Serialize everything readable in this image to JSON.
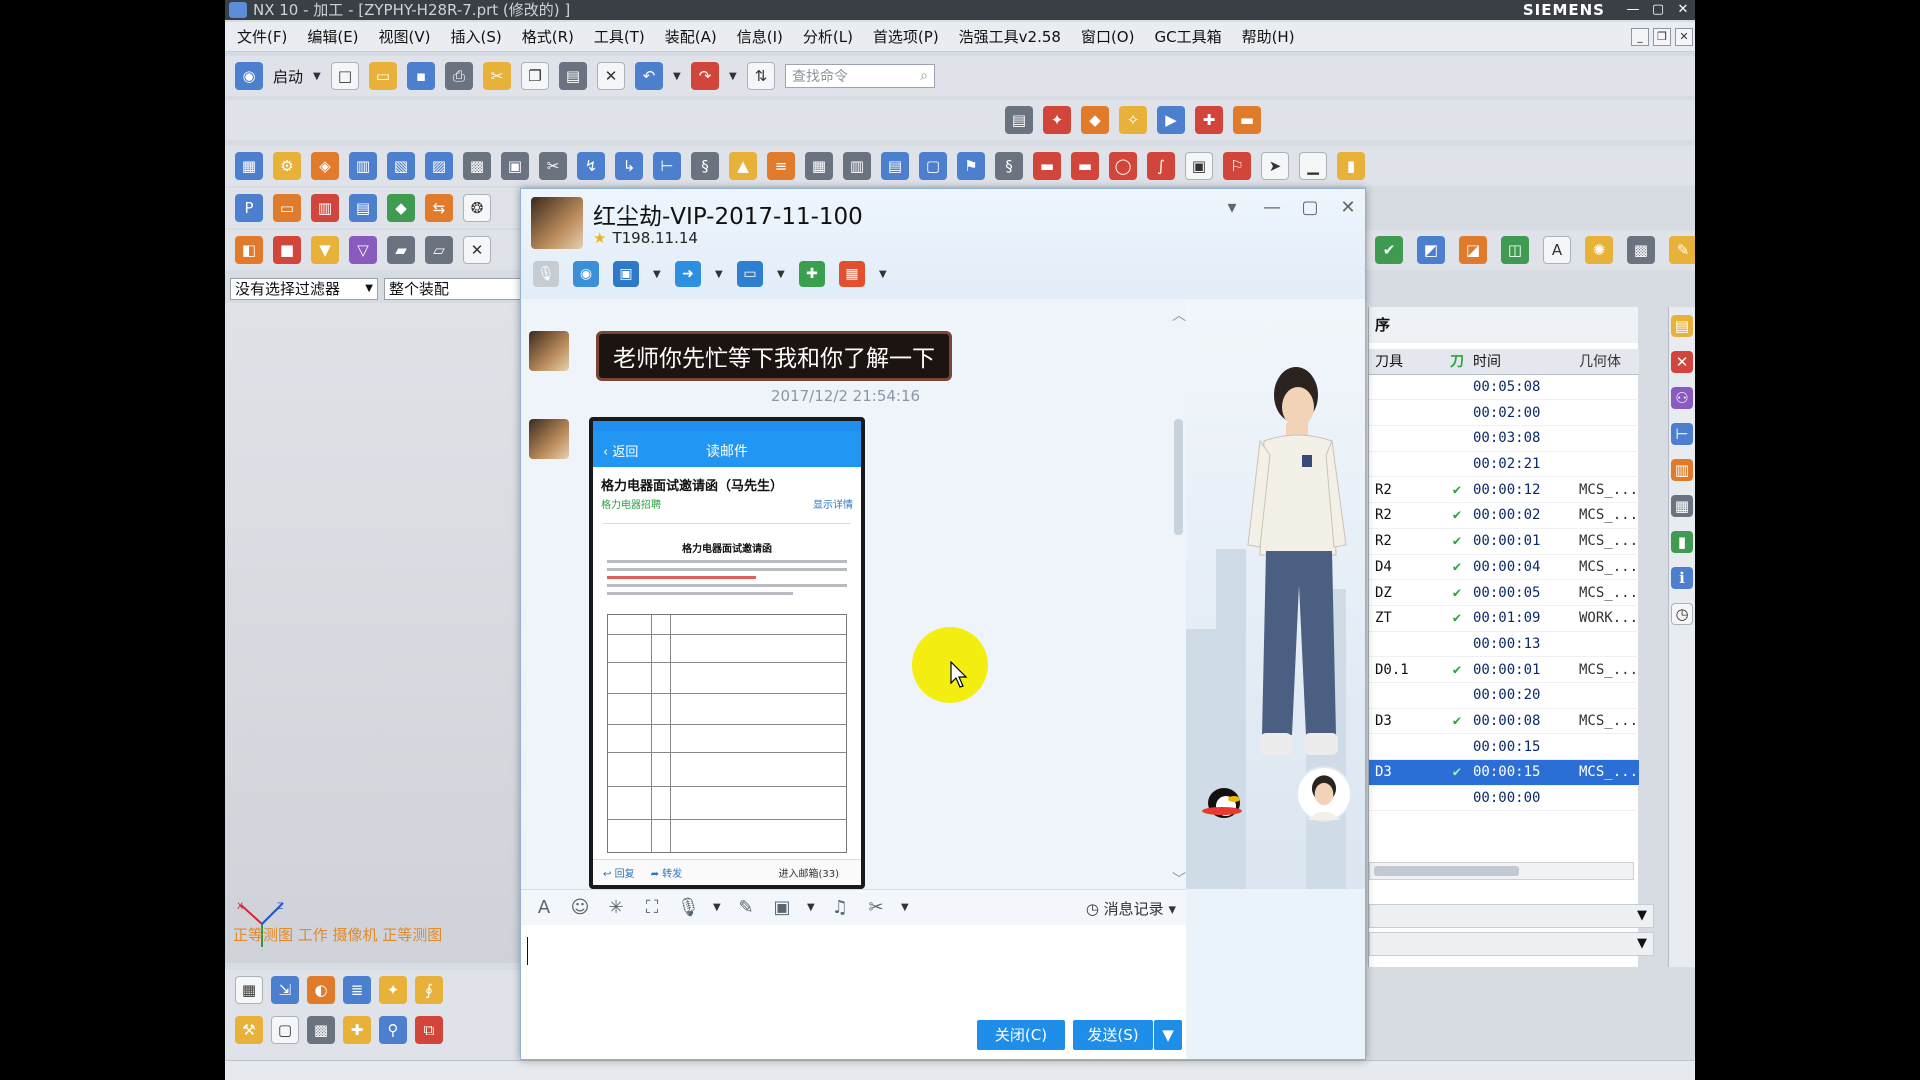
{
  "nx": {
    "title": "NX 10 - 加工 - [ZYPHY-H28R-7.prt  (修改的) ]",
    "brand": "SIEMENS",
    "menu": [
      "文件(F)",
      "编辑(E)",
      "视图(V)",
      "插入(S)",
      "格式(R)",
      "工具(T)",
      "装配(A)",
      "信息(I)",
      "分析(L)",
      "首选项(P)",
      "浩强工具v2.58",
      "窗口(O)",
      "GC工具箱",
      "帮助(H)"
    ],
    "start_label": "启动",
    "search_placeholder": "查找命令",
    "filter": {
      "selection_filter": "没有选择过滤器",
      "scope": "整个装配"
    },
    "view_labels": "正等测图 工作 摄像机 正等测图",
    "axis": {
      "x": "X",
      "z": "Z"
    }
  },
  "navigator": {
    "title": "序",
    "columns": [
      "刀具",
      "刀",
      "时间",
      "几何体"
    ],
    "rows": [
      {
        "tool": "",
        "check": "",
        "time": "00:05:08",
        "geom": ""
      },
      {
        "tool": "",
        "check": "",
        "time": "00:02:00",
        "geom": ""
      },
      {
        "tool": "",
        "check": "",
        "time": "00:03:08",
        "geom": ""
      },
      {
        "tool": "",
        "check": "",
        "time": "00:02:21",
        "geom": ""
      },
      {
        "tool": "R2",
        "check": "✔",
        "time": "00:00:12",
        "geom": "MCS_..."
      },
      {
        "tool": "R2",
        "check": "✔",
        "time": "00:00:02",
        "geom": "MCS_..."
      },
      {
        "tool": "R2",
        "check": "✔",
        "time": "00:00:01",
        "geom": "MCS_..."
      },
      {
        "tool": "D4",
        "check": "✔",
        "time": "00:00:04",
        "geom": "MCS_..."
      },
      {
        "tool": "DZ",
        "check": "✔",
        "time": "00:00:05",
        "geom": "MCS_..."
      },
      {
        "tool": "ZT",
        "check": "✔",
        "time": "00:01:09",
        "geom": "WORK..."
      },
      {
        "tool": "",
        "check": "",
        "time": "00:00:13",
        "geom": ""
      },
      {
        "tool": "D0.1",
        "check": "✔",
        "time": "00:00:01",
        "geom": "MCS_..."
      },
      {
        "tool": "",
        "check": "",
        "time": "00:00:20",
        "geom": ""
      },
      {
        "tool": "D3",
        "check": "✔",
        "time": "00:00:08",
        "geom": "MCS_..."
      },
      {
        "tool": "",
        "check": "",
        "time": "00:00:15",
        "geom": ""
      },
      {
        "tool": "D3",
        "check": "✔",
        "time": "00:00:15",
        "geom": "MCS_..."
      },
      {
        "tool": "",
        "check": "",
        "time": "00:00:00",
        "geom": ""
      }
    ],
    "selected_index": 15
  },
  "qq": {
    "contact_name": "红尘劫-VIP-2017-11-100",
    "contact_sub": "T198.11.14",
    "message_text": "老师你先忙等下我和你了解一下",
    "message_time": "2017/12/2 21:54:16",
    "history_label": "消息记录",
    "close_label": "关闭(C)",
    "send_label": "发送(S)",
    "phone": {
      "back": "返回",
      "title": "读邮件",
      "subject": "格力电器面试邀请函（马先生）",
      "sender": "格力电器招聘",
      "detail": "显示详情",
      "doc_title": "格力电器面试邀请函",
      "reply": "回复",
      "forward": "转发",
      "mailbox": "进入邮箱(33)"
    }
  },
  "colors": {
    "accent": "#2196f3",
    "selection": "#2b6fd6",
    "check": "#2aa440",
    "send_button": "#1f8ee8",
    "cursor_highlight": "#f4ee10"
  }
}
